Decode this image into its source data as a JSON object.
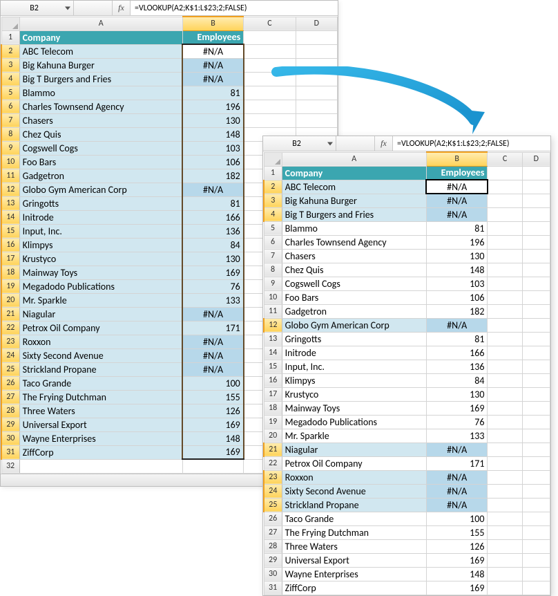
{
  "back": {
    "namebox": "B2",
    "fx": "fx",
    "formula": "=VLOOKUP(A2;K$1:L$23;2;FALSE)",
    "cols": [
      "",
      "A",
      "B",
      "C",
      "D"
    ],
    "header": {
      "A": "Company",
      "B": "Employees"
    },
    "rows": [
      {
        "n": 2,
        "A": "ABC Telecom",
        "B": "#N/A",
        "na": true,
        "active": true
      },
      {
        "n": 3,
        "A": "Big Kahuna Burger",
        "B": "#N/A",
        "na": true
      },
      {
        "n": 4,
        "A": "Big T Burgers and Fries",
        "B": "#N/A",
        "na": true
      },
      {
        "n": 5,
        "A": "Blammo",
        "B": "81"
      },
      {
        "n": 6,
        "A": "Charles Townsend Agency",
        "B": "196"
      },
      {
        "n": 7,
        "A": "Chasers",
        "B": "130"
      },
      {
        "n": 8,
        "A": "Chez Quis",
        "B": "148"
      },
      {
        "n": 9,
        "A": "Cogswell Cogs",
        "B": "103"
      },
      {
        "n": 10,
        "A": "Foo Bars",
        "B": "106"
      },
      {
        "n": 11,
        "A": "Gadgetron",
        "B": "182"
      },
      {
        "n": 12,
        "A": "Globo Gym American Corp",
        "B": "#N/A",
        "na": true
      },
      {
        "n": 13,
        "A": "Gringotts",
        "B": "81"
      },
      {
        "n": 14,
        "A": "Initrode",
        "B": "166"
      },
      {
        "n": 15,
        "A": "Input, Inc.",
        "B": "136"
      },
      {
        "n": 16,
        "A": "Klimpys",
        "B": "84"
      },
      {
        "n": 17,
        "A": "Krustyco",
        "B": "130"
      },
      {
        "n": 18,
        "A": "Mainway Toys",
        "B": "169"
      },
      {
        "n": 19,
        "A": "Megadodo Publications",
        "B": "76"
      },
      {
        "n": 20,
        "A": "Mr. Sparkle",
        "B": "133"
      },
      {
        "n": 21,
        "A": "Niagular",
        "B": "#N/A",
        "na": true
      },
      {
        "n": 22,
        "A": "Petrox Oil Company",
        "B": "171"
      },
      {
        "n": 23,
        "A": "Roxxon",
        "B": "#N/A",
        "na": true
      },
      {
        "n": 24,
        "A": "Sixty Second Avenue",
        "B": "#N/A",
        "na": true
      },
      {
        "n": 25,
        "A": "Strickland Propane",
        "B": "#N/A",
        "na": true
      },
      {
        "n": 26,
        "A": "Taco Grande",
        "B": "100"
      },
      {
        "n": 27,
        "A": "The Frying Dutchman",
        "B": "155"
      },
      {
        "n": 28,
        "A": "Three Waters",
        "B": "126"
      },
      {
        "n": 29,
        "A": "Universal Export",
        "B": "169"
      },
      {
        "n": 30,
        "A": "Wayne Enterprises",
        "B": "148"
      },
      {
        "n": 31,
        "A": "ZiffCorp",
        "B": "169"
      }
    ]
  },
  "front": {
    "namebox": "B2",
    "fx": "fx",
    "formula": "=VLOOKUP(A2;K$1:L$23;2;FALSE)",
    "cols": [
      "",
      "A",
      "B",
      "C",
      "D"
    ],
    "header": {
      "A": "Company",
      "B": "Employees"
    },
    "rows": [
      {
        "n": 2,
        "A": "ABC Telecom",
        "B": "#N/A",
        "na": true,
        "active": true,
        "hi": true
      },
      {
        "n": 3,
        "A": "Big Kahuna Burger",
        "B": "#N/A",
        "na": true,
        "hi": true
      },
      {
        "n": 4,
        "A": "Big T Burgers and Fries",
        "B": "#N/A",
        "na": true,
        "hi": true
      },
      {
        "n": 5,
        "A": "Blammo",
        "B": "81"
      },
      {
        "n": 6,
        "A": "Charles Townsend Agency",
        "B": "196"
      },
      {
        "n": 7,
        "A": "Chasers",
        "B": "130"
      },
      {
        "n": 8,
        "A": "Chez Quis",
        "B": "148"
      },
      {
        "n": 9,
        "A": "Cogswell Cogs",
        "B": "103"
      },
      {
        "n": 10,
        "A": "Foo Bars",
        "B": "106"
      },
      {
        "n": 11,
        "A": "Gadgetron",
        "B": "182"
      },
      {
        "n": 12,
        "A": "Globo Gym American Corp",
        "B": "#N/A",
        "na": true,
        "hi": true
      },
      {
        "n": 13,
        "A": "Gringotts",
        "B": "81"
      },
      {
        "n": 14,
        "A": "Initrode",
        "B": "166"
      },
      {
        "n": 15,
        "A": "Input, Inc.",
        "B": "136"
      },
      {
        "n": 16,
        "A": "Klimpys",
        "B": "84"
      },
      {
        "n": 17,
        "A": "Krustyco",
        "B": "130"
      },
      {
        "n": 18,
        "A": "Mainway Toys",
        "B": "169"
      },
      {
        "n": 19,
        "A": "Megadodo Publications",
        "B": "76"
      },
      {
        "n": 20,
        "A": "Mr. Sparkle",
        "B": "133"
      },
      {
        "n": 21,
        "A": "Niagular",
        "B": "#N/A",
        "na": true,
        "hi": true
      },
      {
        "n": 22,
        "A": "Petrox Oil Company",
        "B": "171"
      },
      {
        "n": 23,
        "A": "Roxxon",
        "B": "#N/A",
        "na": true,
        "hi": true
      },
      {
        "n": 24,
        "A": "Sixty Second Avenue",
        "B": "#N/A",
        "na": true,
        "hi": true
      },
      {
        "n": 25,
        "A": "Strickland Propane",
        "B": "#N/A",
        "na": true,
        "hi": true
      },
      {
        "n": 26,
        "A": "Taco Grande",
        "B": "100"
      },
      {
        "n": 27,
        "A": "The Frying Dutchman",
        "B": "155"
      },
      {
        "n": 28,
        "A": "Three Waters",
        "B": "126"
      },
      {
        "n": 29,
        "A": "Universal Export",
        "B": "169"
      },
      {
        "n": 30,
        "A": "Wayne Enterprises",
        "B": "148"
      },
      {
        "n": 31,
        "A": "ZiffCorp",
        "B": "169"
      }
    ]
  }
}
